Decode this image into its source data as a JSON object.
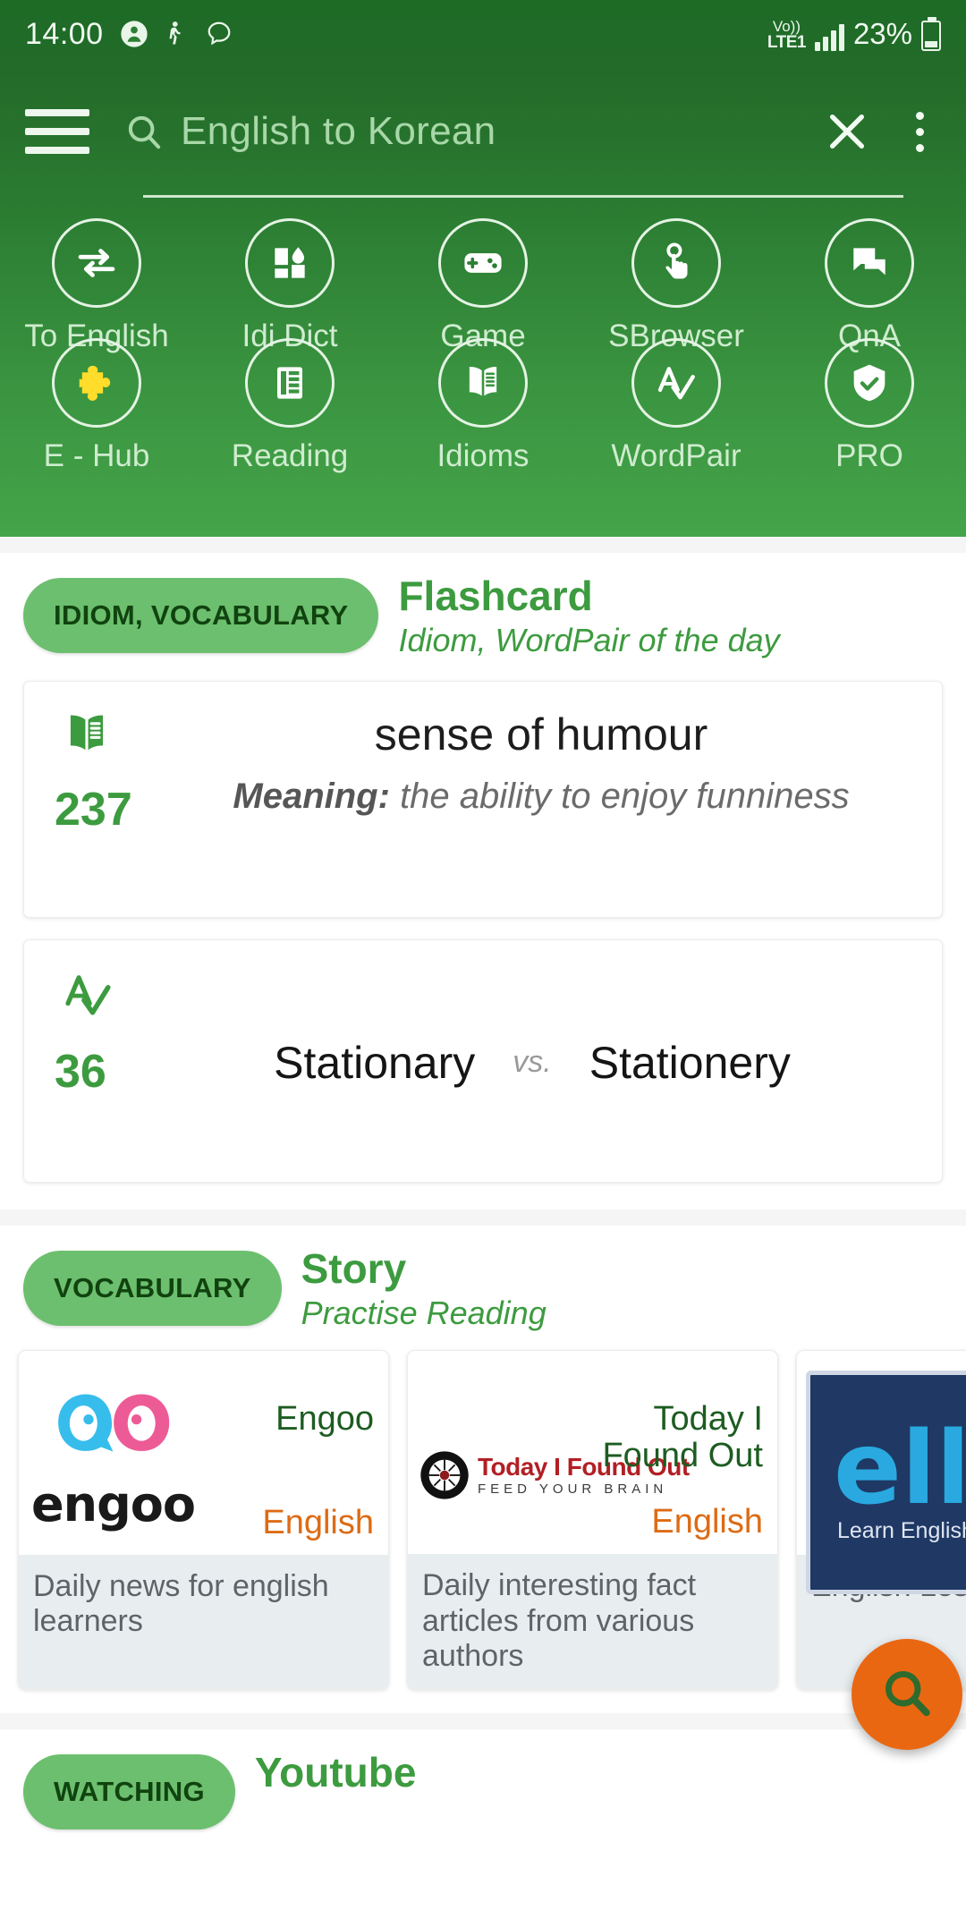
{
  "status_bar": {
    "time": "14:00",
    "icons": [
      "person-icon",
      "hiking-icon",
      "chat-bubble-icon"
    ],
    "network_top": "Vo))",
    "network_bottom": "LTE1",
    "battery_percent": "23%"
  },
  "search": {
    "placeholder": "English to Korean",
    "value": "",
    "menu_icon": "hamburger-icon",
    "clear_icon": "close-icon",
    "overflow_icon": "more-vert-icon",
    "search_icon": "search-icon"
  },
  "quick_actions": [
    {
      "label": "To English",
      "icon": "swap-arrows-icon"
    },
    {
      "label": "Idi Dict",
      "icon": "dashboard-blocks-icon"
    },
    {
      "label": "Game",
      "icon": "gamepad-icon"
    },
    {
      "label": "SBrowser",
      "icon": "tap-finger-icon"
    },
    {
      "label": "QnA",
      "icon": "chat-bubbles-icon"
    },
    {
      "label": "E - Hub",
      "icon": "puzzle-piece-icon"
    },
    {
      "label": "Reading",
      "icon": "article-icon"
    },
    {
      "label": "Idioms",
      "icon": "open-book-icon"
    },
    {
      "label": "WordPair",
      "icon": "spellcheck-icon"
    },
    {
      "label": "PRO",
      "icon": "shield-check-icon"
    }
  ],
  "sections": {
    "flashcard": {
      "chip": "IDIOM, VOCABULARY",
      "title": "Flashcard",
      "subtitle": "Idiom, WordPair of the day",
      "idiom_card": {
        "icon": "open-book-icon",
        "count": "237",
        "term": "sense of humour",
        "meaning_label": "Meaning:",
        "meaning_text": "the ability to enjoy funniness"
      },
      "wordpair_card": {
        "icon": "spellcheck-icon",
        "count": "36",
        "word_left": "Stationary",
        "separator": "vs.",
        "word_right": "Stationery"
      }
    },
    "story": {
      "chip": "VOCABULARY",
      "title": "Story",
      "subtitle": "Practise Reading",
      "cards": [
        {
          "logo": "engoo-logo",
          "name": "Engoo",
          "language": "English",
          "description": "Daily news for english learners"
        },
        {
          "logo": "today-i-found-out-logo",
          "logo_text": "Today I Found Out",
          "logo_tagline": "FEED YOUR BRAIN",
          "name": "Today I\nFound Out",
          "name_line1": "Today I",
          "name_line2": "Found Out",
          "language": "English",
          "description": "Daily interesting fact articles from various authors"
        },
        {
          "logo": "ello-logo",
          "logo_text": "ello",
          "logo_tagline": "Learn English Naturally",
          "name": "",
          "language": "",
          "description": "English Lesson L"
        }
      ]
    },
    "youtube": {
      "chip": "WATCHING",
      "title": "Youtube"
    }
  },
  "fab": {
    "icon": "search-icon",
    "color": "#ea6712"
  },
  "colors": {
    "header_green_dark": "#1d6b26",
    "header_green_light": "#44a449",
    "accent_green": "#3d9b3f",
    "chip_green": "#6cbf6e",
    "lang_orange": "#dd6b14",
    "fab_orange": "#ea6712"
  }
}
